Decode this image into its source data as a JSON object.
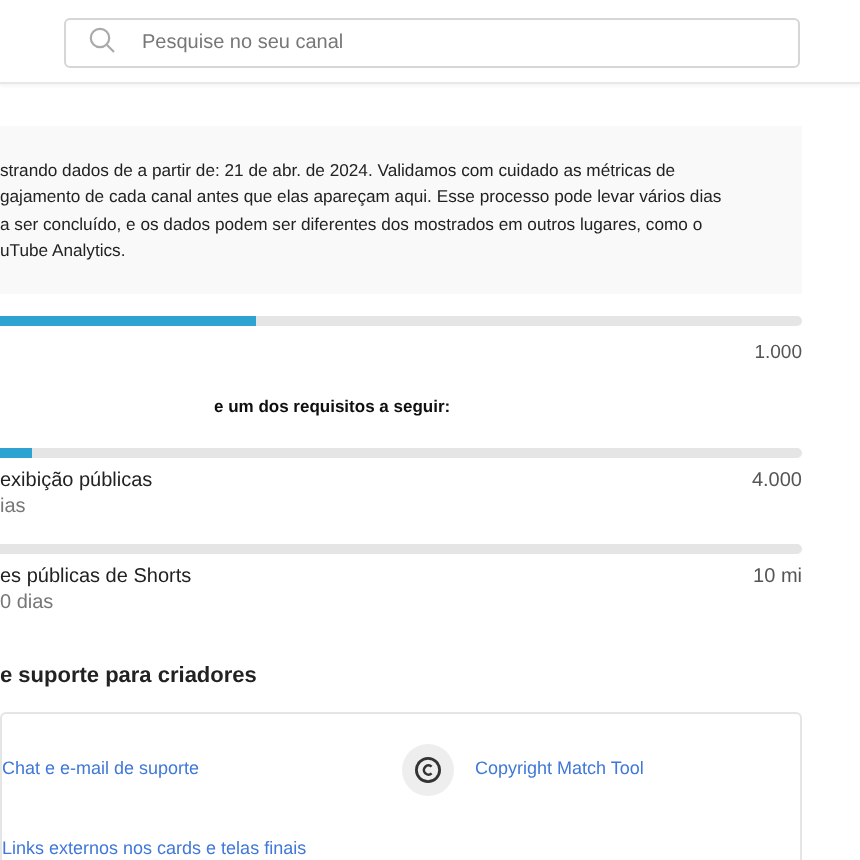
{
  "search": {
    "placeholder": "Pesquise no seu canal"
  },
  "notice": {
    "lines": [
      "strando dados de a partir de: 21 de abr. de 2024. Validamos com cuidado as métricas de",
      "gajamento de cada canal antes que elas apareçam aqui. Esse processo pode levar vários dias",
      "a ser concluído, e os dados podem ser diferentes dos mostrados em outros lugares, como o",
      "uTube Analytics."
    ]
  },
  "first_requirement": {
    "level": 0.32,
    "target": "1.000"
  },
  "requirements_intro": "e um dos requisitos a seguir:",
  "requirements": [
    {
      "level": 0.04,
      "label": "exibição públicas",
      "sublabel": "ias",
      "target": "4.000"
    },
    {
      "label": "es públicas de Shorts",
      "sublabel": "0 dias",
      "target": "10 mi"
    }
  ],
  "support": {
    "heading": "e suporte para criadores",
    "items": [
      {
        "kind": "plain",
        "label": "Chat e e-mail de suporte"
      },
      {
        "kind": "copyright",
        "label": "Copyright Match Tool"
      },
      {
        "kind": "plain",
        "label": "Links externos nos cards e telas finais"
      }
    ]
  }
}
